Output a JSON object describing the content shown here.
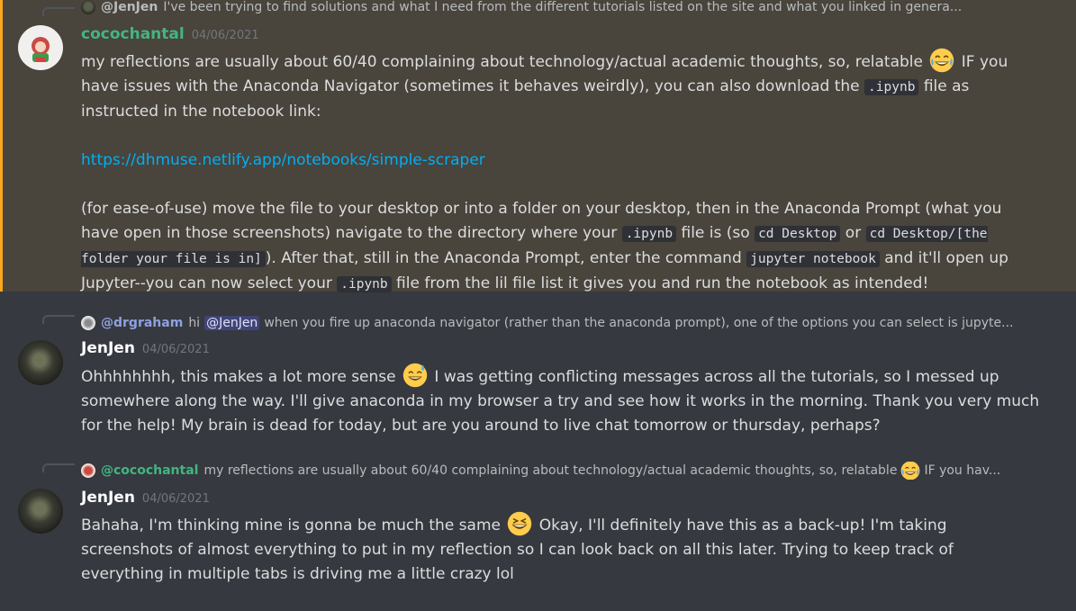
{
  "top_reply": {
    "author": "@JenJen",
    "text": "I've been trying to find solutions and what I need from the different tutorials listed on the site and what you linked in genera..."
  },
  "messages": [
    {
      "author": "cocochantal",
      "timestamp": "04/06/2021",
      "p1_a": "my reflections are usually about 60/40 complaining about technology/actual academic thoughts, so, relatable",
      "p1_b": "IF you have issues with the Anaconda Navigator (sometimes it behaves weirdly), you can also download the",
      "p1_code": ".ipynb",
      "p1_c": "file as instructed in the notebook link:",
      "link": "https://dhmuse.netlify.app/notebooks/simple-scraper",
      "p2_a": "(for ease-of-use) move the file to your desktop or into a folder on your desktop, then in the Anaconda Prompt (what you have open in those screenshots) navigate to the directory where your",
      "p2_code1": ".ipynb",
      "p2_b": "file is (so",
      "p2_code2": "cd Desktop",
      "p2_c": "or",
      "p2_code3": "cd Desktop/[the folder your file is in]",
      "p2_d": "). After that, still in the Anaconda Prompt, enter the command",
      "p2_code4": "jupyter notebook",
      "p2_e": "and it'll open up Jupyter--you can now select your",
      "p2_code5": ".ipynb",
      "p2_f": "file from the lil file list it gives you and run the notebook as intended!"
    },
    {
      "reply_author": "@drgraham",
      "reply_pre": "hi",
      "reply_mention": "@JenJen",
      "reply_text": "when you fire up anaconda navigator (rather than the anaconda prompt), one of the options you can select is jupyte...",
      "author": "JenJen",
      "timestamp": "04/06/2021",
      "text_a": "Ohhhhhhhh, this makes a lot more sense",
      "text_b": "I was getting conflicting messages across all the tutorials, so I messed up somewhere along the way. I'll give anaconda in my browser a try and see how it works in the morning. Thank you very much for the help! My brain is dead for today, but are you around to live chat tomorrow or thursday, perhaps?"
    },
    {
      "reply_author": "@cocochantal",
      "reply_text": "my reflections are usually about 60/40 complaining about technology/actual academic thoughts, so, relatable",
      "reply_text_b": "IF you hav...",
      "author": "JenJen",
      "timestamp": "04/06/2021",
      "text_a": "Bahaha, I'm thinking mine is gonna be much the same",
      "text_b": "Okay, I'll definitely have this as a back-up! I'm taking screenshots of almost everything to put in my reflection so I can look back on all this later. Trying to keep track of everything in multiple tabs is driving me a little crazy lol"
    }
  ],
  "emoji": {
    "joy": "face-with-tears-of-joy-icon",
    "sweat_smile": "grinning-face-with-sweat-icon",
    "laughing": "grinning-squinting-face-icon"
  },
  "colors": {
    "background": "#36393f",
    "highlight": "#49443c",
    "highlight_bar": "#faa81a",
    "link": "#00aff4",
    "green_name": "#43b581"
  }
}
